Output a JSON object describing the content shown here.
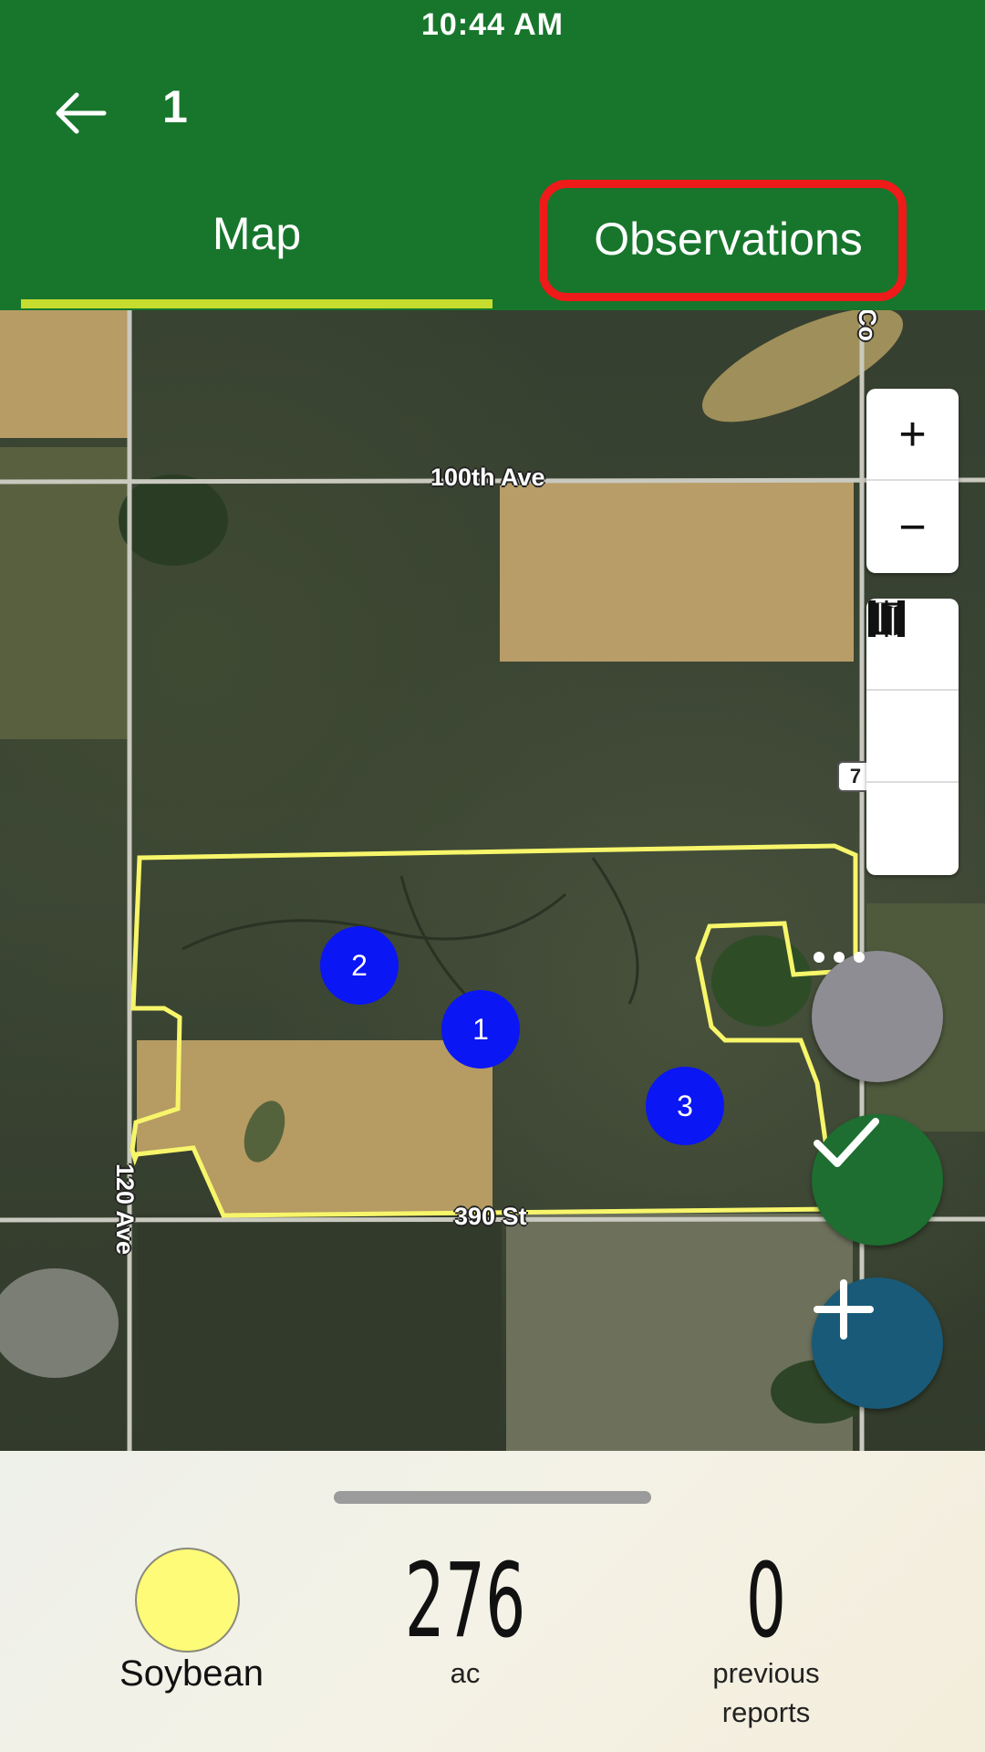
{
  "status_bar": {
    "time": "10:44 AM"
  },
  "header": {
    "title": "1",
    "tabs": [
      {
        "label": "Map",
        "selected": true
      },
      {
        "label": "Observations",
        "selected": false,
        "highlighted": true
      }
    ]
  },
  "map": {
    "road_labels": [
      "100th Ave",
      "390 St",
      "120 Ave",
      "Co"
    ],
    "route_shield": "7",
    "markers": [
      "1",
      "2",
      "3"
    ],
    "field_boundary_color": "#f7f56a"
  },
  "map_controls": {
    "zoom_in": "+",
    "zoom_out": "−",
    "icons": [
      "crosshair-icon",
      "zoom-to-field-icon",
      "map-layers-icon"
    ]
  },
  "fabs": [
    {
      "name": "more",
      "icon": "ellipsis-icon",
      "color": "#8e8d93"
    },
    {
      "name": "done",
      "icon": "checkmark-icon",
      "color": "#1d6e30"
    },
    {
      "name": "add",
      "icon": "plus-icon",
      "color": "#195a78"
    }
  ],
  "summary": {
    "crop": {
      "name": "Soybean",
      "color": "#fdfb77"
    },
    "area": {
      "value": "276",
      "unit": "ac"
    },
    "reports": {
      "value": "0",
      "label_line1": "previous",
      "label_line2": "reports"
    }
  },
  "colors": {
    "header": "#17762c",
    "tab_indicator": "#c6dc2f",
    "marker": "#0a16f4",
    "highlight": "#ef1a1a"
  }
}
